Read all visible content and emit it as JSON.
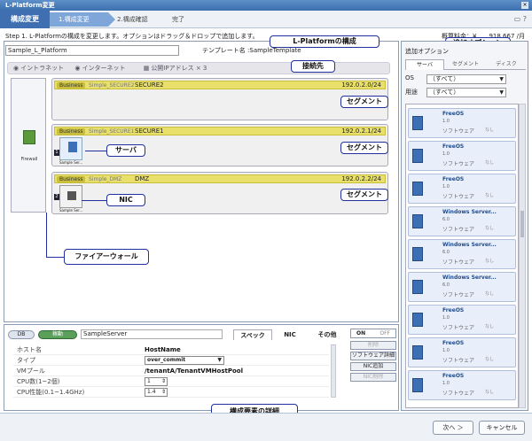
{
  "window": {
    "title": "L-Platform変更"
  },
  "steps": {
    "main": "構成変更",
    "s1": "1.構成変更",
    "s2": "2.構成確認",
    "s3": "完了"
  },
  "step_text": "Step 1. L-Platformの構成を変更します。オプションはドラッグ＆ドロップで追加します。",
  "fee": "概算料金：¥　　918,667 /月",
  "platform": {
    "name": "Sample_L_Platform",
    "template_label": "テンプレート名 :SampleTemplate"
  },
  "network": {
    "intranet": "イントラネット",
    "internet": "インターネット",
    "public_ip": "公開IPアドレス × 3"
  },
  "firewall": {
    "label": "Firewall"
  },
  "segments": [
    {
      "badge": "Business",
      "sub": "Simple_SECURE2",
      "name": "SECURE2",
      "ip": "192.0.2.0/24"
    },
    {
      "badge": "Business",
      "sub": "Simple_SECURE1",
      "name": "SECURE1",
      "ip": "192.0.2.1/24",
      "node_num": "1",
      "node_label": "Sample Ser..."
    },
    {
      "badge": "Business",
      "sub": "Simple_DMZ",
      "name": "DMZ",
      "ip": "192.0.2.2/24",
      "node_num": "2",
      "node_label": "Sample Ser..."
    }
  ],
  "callouts": {
    "lplatform": "L-Platformの構成",
    "options": "追加オプション",
    "connection": "接続先",
    "segment1": "セグメント",
    "segment2": "セグメント",
    "segment3": "セグメント",
    "server": "サーバ",
    "nic": "NIC",
    "firewall": "ファイアーウォール",
    "details": "構成要素の詳細"
  },
  "options": {
    "title": "追加オプション",
    "tabs": [
      "サーバ",
      "セグメント",
      "ディスク"
    ],
    "os_label": "OS",
    "os_value": "（すべて）",
    "use_label": "用途",
    "use_value": "（すべて）",
    "items": [
      {
        "name": "FreeOS",
        "ver": "1.0",
        "type": "ソフトウェア",
        "none": "なし"
      },
      {
        "name": "FreeOS",
        "ver": "1.0",
        "type": "ソフトウェア",
        "none": "なし"
      },
      {
        "name": "FreeOS",
        "ver": "1.0",
        "type": "ソフトウェア",
        "none": "なし"
      },
      {
        "name": "Windows Server...",
        "ver": "6.0",
        "type": "ソフトウェア",
        "none": "なし"
      },
      {
        "name": "Windows Server...",
        "ver": "6.0",
        "type": "ソフトウェア",
        "none": "なし"
      },
      {
        "name": "Windows Server...",
        "ver": "6.0",
        "type": "ソフトウェア",
        "none": "なし"
      },
      {
        "name": "FreeOS",
        "ver": "1.0",
        "type": "ソフトウェア",
        "none": "なし"
      },
      {
        "name": "FreeOS",
        "ver": "1.0",
        "type": "ソフトウェア",
        "none": "なし"
      },
      {
        "name": "FreeOS",
        "ver": "1.0",
        "type": "ソフトウェア",
        "none": "なし"
      }
    ]
  },
  "details": {
    "db": "DB",
    "running": "稼動",
    "server_name": "SampleServer",
    "tabs": [
      "スペック",
      "NIC",
      "その他"
    ],
    "toggle_on": "ON",
    "toggle_off": "OFF",
    "btn_delete": "削除",
    "btn_software": "ソフトウェア詳細",
    "btn_nic_add": "NIC追加",
    "btn_nic_del": "NIC削除",
    "rows": [
      {
        "key": "ホスト名",
        "value": "HostName"
      },
      {
        "key": "タイプ",
        "value": "over_commit"
      },
      {
        "key": "VMプール",
        "value": "/tenantA/TenantVMHostPool"
      },
      {
        "key": "CPU数(1~2個)",
        "value": "1"
      },
      {
        "key": "CPU性能(0.1~1.4GHz)",
        "value": "1.4"
      }
    ]
  },
  "footer": {
    "next": "次へ ＞",
    "cancel": "キャンセル"
  }
}
